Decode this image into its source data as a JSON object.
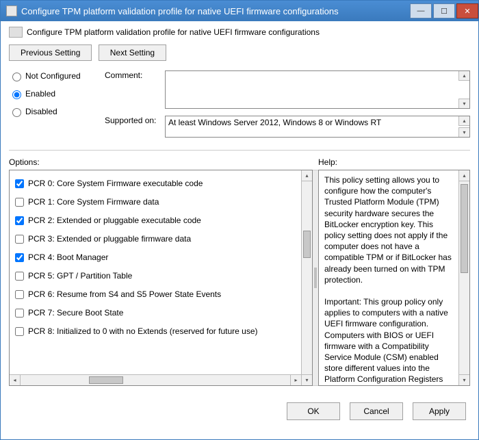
{
  "window": {
    "title": "Configure TPM platform validation profile for native UEFI firmware configurations",
    "subtitle": "Configure TPM platform validation profile for native UEFI firmware configurations"
  },
  "nav": {
    "prev": "Previous Setting",
    "next": "Next Setting"
  },
  "state": {
    "not_configured": "Not Configured",
    "enabled": "Enabled",
    "disabled": "Disabled",
    "selected": "enabled"
  },
  "fields": {
    "comment_label": "Comment:",
    "comment_value": "",
    "supported_label": "Supported on:",
    "supported_value": "At least Windows Server 2012, Windows 8 or Windows RT"
  },
  "labels": {
    "options": "Options:",
    "help": "Help:"
  },
  "options": [
    {
      "checked": true,
      "label": "PCR 0: Core System Firmware executable code"
    },
    {
      "checked": false,
      "label": "PCR 1: Core System Firmware data"
    },
    {
      "checked": true,
      "label": "PCR 2: Extended or pluggable executable code"
    },
    {
      "checked": false,
      "label": "PCR 3: Extended or pluggable firmware data"
    },
    {
      "checked": true,
      "label": "PCR 4: Boot Manager"
    },
    {
      "checked": false,
      "label": "PCR 5: GPT / Partition Table"
    },
    {
      "checked": false,
      "label": "PCR 6: Resume from S4 and S5 Power State Events"
    },
    {
      "checked": false,
      "label": "PCR 7: Secure Boot State"
    },
    {
      "checked": false,
      "label": "PCR 8: Initialized to 0 with no Extends (reserved for future use)"
    }
  ],
  "help_text": "This policy setting allows you to configure how the computer's Trusted Platform Module (TPM) security hardware secures the BitLocker encryption key. This policy setting does not apply if the computer does not have a compatible TPM or if BitLocker has already been turned on with TPM protection.\n\nImportant: This group policy only applies to computers with a native UEFI firmware configuration. Computers with BIOS or UEFI firmware with a Compatibility Service Module (CSM) enabled store different values into the Platform Configuration Registers (PCRs). Use the \"Configure TPM platform validation profile for BIOS-based firmware configurations\" group policy setting to configure the TPM PCR profile for computers with BIOS configurations or computers with UEFI firmware with a CSM enabled.\n\nIf you enable this policy setting before turning on BitLocker, you can configure the boot components that the TPM will validate before unlocking access to the BitLocker-encrypted operating",
  "buttons": {
    "ok": "OK",
    "cancel": "Cancel",
    "apply": "Apply"
  }
}
